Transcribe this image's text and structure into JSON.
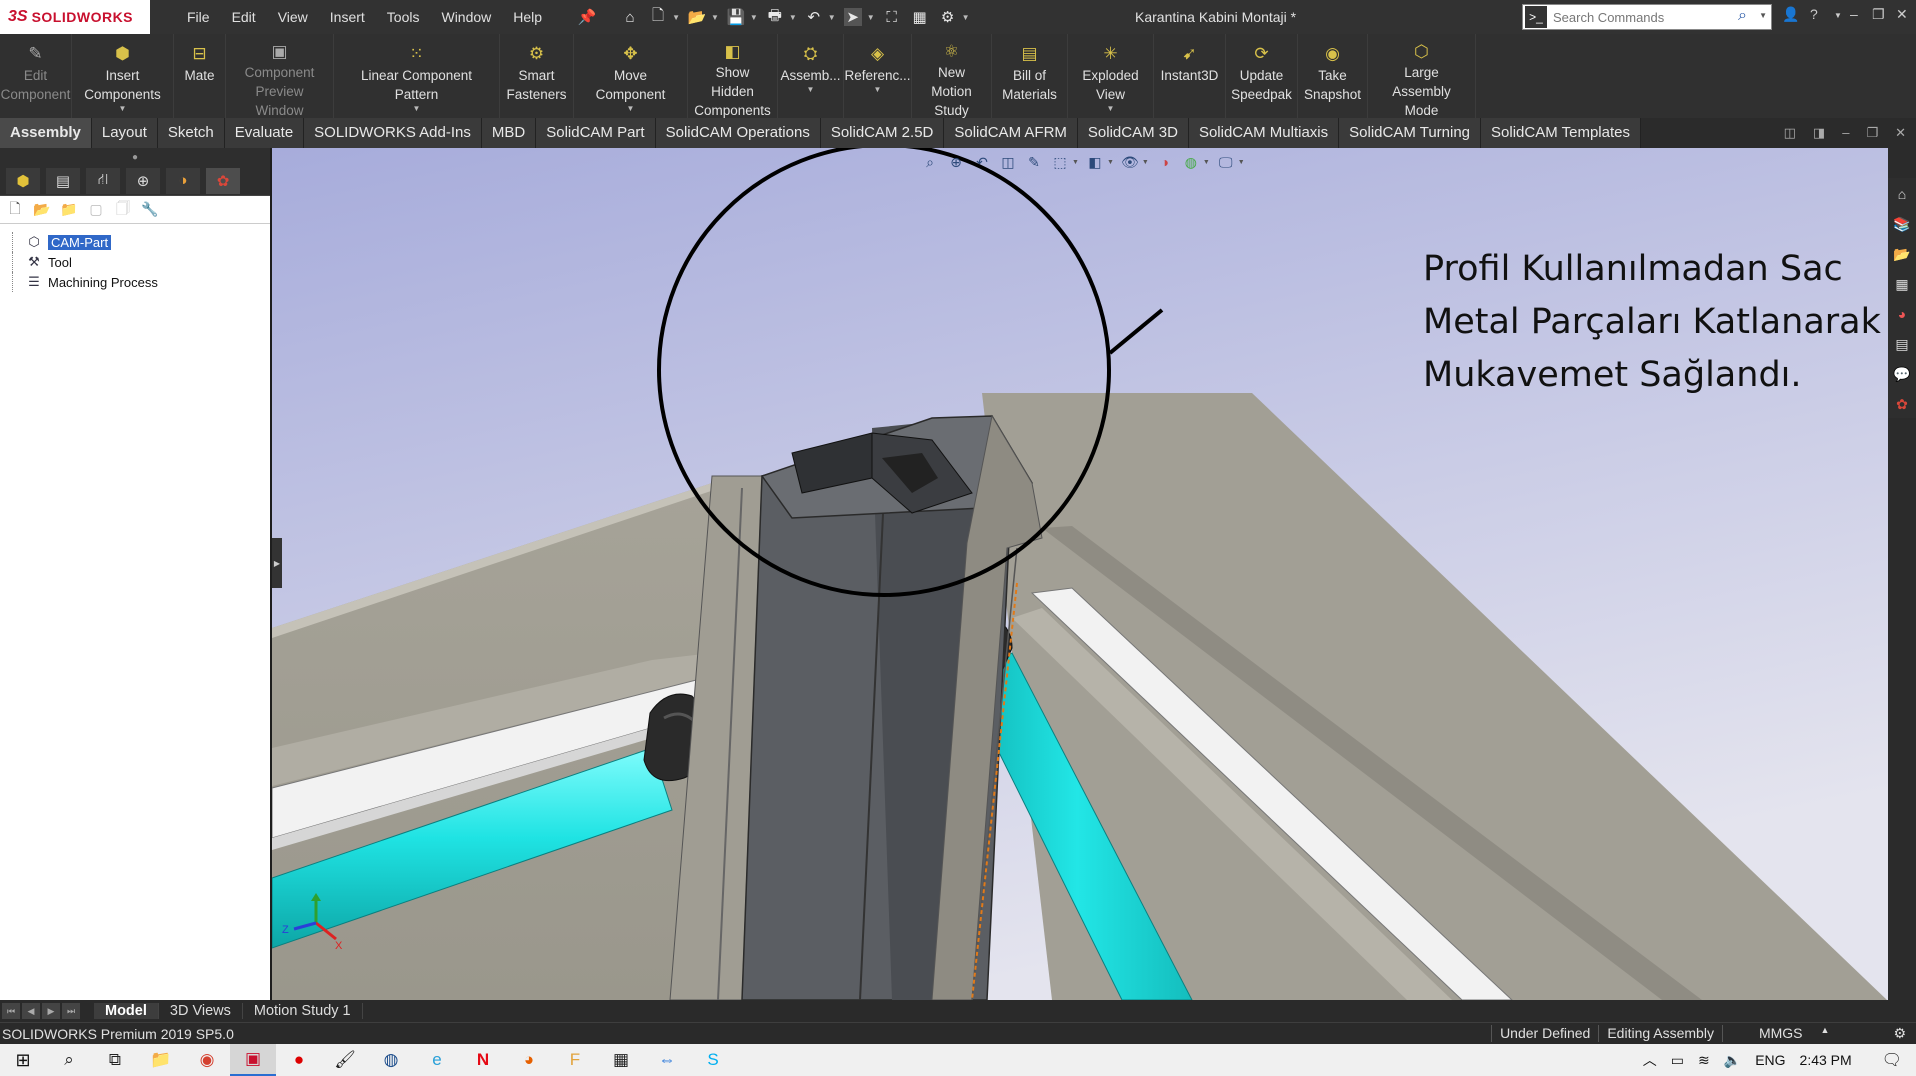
{
  "app": {
    "logo_ds": "3S",
    "logo_text": "SOLIDWORKS",
    "document_title": "Karantina Kabini Montaji *"
  },
  "menu": [
    "File",
    "Edit",
    "View",
    "Insert",
    "Tools",
    "Window",
    "Help"
  ],
  "search": {
    "placeholder": "Search Commands"
  },
  "commands": [
    {
      "label": "Edit Component",
      "icon": "edit-component-icon",
      "glyph": "✎",
      "disabled": true,
      "dropdown": false,
      "width": 72
    },
    {
      "label": "Insert Components",
      "icon": "insert-components-icon",
      "glyph": "⬢",
      "disabled": false,
      "dropdown": true,
      "width": 102
    },
    {
      "label": "Mate",
      "icon": "mate-icon",
      "glyph": "⊟",
      "disabled": false,
      "dropdown": false,
      "width": 52
    },
    {
      "label": "Component Preview Window",
      "icon": "component-preview-icon",
      "glyph": "▣",
      "disabled": true,
      "dropdown": false,
      "width": 108
    },
    {
      "label": "Linear Component Pattern",
      "icon": "linear-pattern-icon",
      "glyph": "⁙",
      "disabled": false,
      "dropdown": true,
      "width": 166
    },
    {
      "label": "Smart Fasteners",
      "icon": "smart-fasteners-icon",
      "glyph": "⚙",
      "disabled": false,
      "dropdown": false,
      "width": 74
    },
    {
      "label": "Move Component",
      "icon": "move-component-icon",
      "glyph": "✥",
      "disabled": false,
      "dropdown": true,
      "width": 114
    },
    {
      "label": "Show Hidden Components",
      "icon": "show-hidden-icon",
      "glyph": "◧",
      "disabled": false,
      "dropdown": false,
      "width": 90
    },
    {
      "label": "Assemb...",
      "icon": "assembly-features-icon",
      "glyph": "⛭",
      "disabled": false,
      "dropdown": true,
      "width": 66
    },
    {
      "label": "Referenc...",
      "icon": "reference-geometry-icon",
      "glyph": "◈",
      "disabled": false,
      "dropdown": true,
      "width": 68
    },
    {
      "label": "New Motion Study",
      "icon": "motion-study-icon",
      "glyph": "⚛",
      "disabled": false,
      "dropdown": false,
      "width": 80
    },
    {
      "label": "Bill of Materials",
      "icon": "bom-icon",
      "glyph": "▤",
      "disabled": false,
      "dropdown": false,
      "width": 76
    },
    {
      "label": "Exploded View",
      "icon": "exploded-view-icon",
      "glyph": "✳",
      "disabled": false,
      "dropdown": true,
      "width": 86
    },
    {
      "label": "Instant3D",
      "icon": "instant3d-icon",
      "glyph": "➹",
      "disabled": false,
      "dropdown": false,
      "width": 72
    },
    {
      "label": "Update Speedpak",
      "icon": "speedpak-icon",
      "glyph": "⟳",
      "disabled": false,
      "dropdown": false,
      "width": 72
    },
    {
      "label": "Take Snapshot",
      "icon": "snapshot-icon",
      "glyph": "◉",
      "disabled": false,
      "dropdown": false,
      "width": 70
    },
    {
      "label": "Large Assembly Mode",
      "icon": "large-assembly-icon",
      "glyph": "⬡",
      "disabled": false,
      "dropdown": false,
      "width": 108
    }
  ],
  "tabs": [
    "Assembly",
    "Layout",
    "Sketch",
    "Evaluate",
    "SOLIDWORKS Add-Ins",
    "MBD",
    "SolidCAM Part",
    "SolidCAM Operations",
    "SolidCAM 2.5D",
    "SolidCAM AFRM",
    "SolidCAM 3D",
    "SolidCAM Multiaxis",
    "SolidCAM Turning",
    "SolidCAM Templates"
  ],
  "active_tab": "Assembly",
  "tree": [
    {
      "label": "CAM-Part",
      "icon": "cam-part-icon",
      "selected": true
    },
    {
      "label": "Tool",
      "icon": "tool-icon",
      "selected": false
    },
    {
      "label": "Machining Process",
      "icon": "machining-process-icon",
      "selected": false
    }
  ],
  "callout": {
    "lines": [
      "Profil Kullanılmadan Sac",
      "Metal Parçaları Katlanarak",
      "Mukavemet Sağlandı."
    ]
  },
  "bottom_tabs": [
    "Model",
    "3D Views",
    "Motion Study 1"
  ],
  "active_bottom_tab": "Model",
  "status": {
    "left": "SOLIDWORKS Premium 2019 SP5.0",
    "state": "Under Defined",
    "mode": "Editing Assembly",
    "units": "MMGS"
  },
  "taskbar": {
    "lang": "ENG",
    "time": "2:43 PM"
  },
  "colors": {
    "pipe": "#1fe3e3",
    "wall": "#a29f95",
    "profile": "#55585d",
    "sky_top": "#a7acdb",
    "sky_bottom": "#dcdde9",
    "selection": "#3068c8"
  }
}
